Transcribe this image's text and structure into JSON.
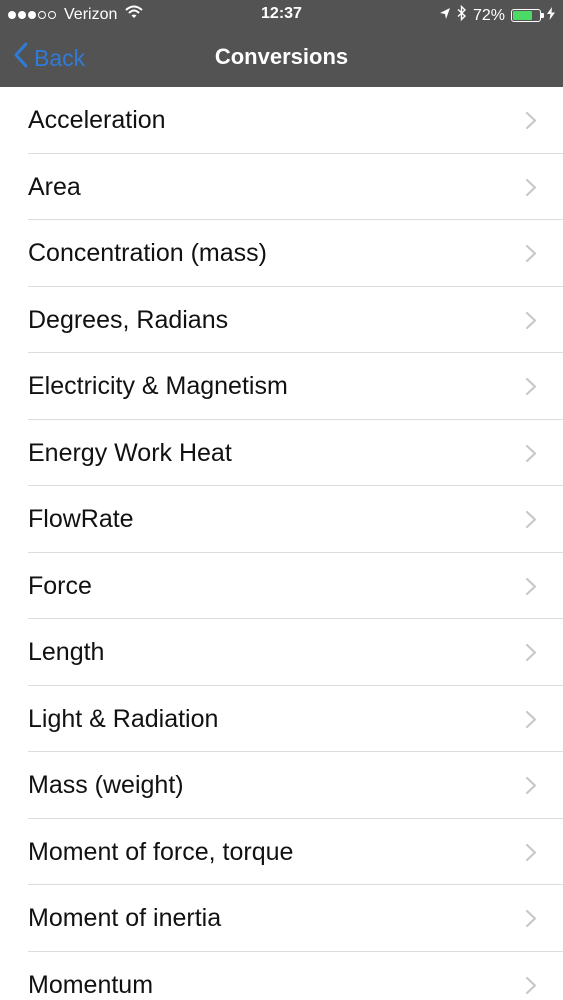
{
  "status_bar": {
    "carrier": "Verizon",
    "time": "12:37",
    "battery_percent_label": "72%",
    "battery_level": 0.72,
    "signal_bars_filled": 3,
    "signal_bars_total": 5
  },
  "nav": {
    "back_label": "Back",
    "title": "Conversions"
  },
  "colors": {
    "nav_background": "#535353",
    "accent": "#2f7bd8",
    "battery": "#4cd964"
  },
  "list": {
    "items": [
      {
        "label": "Acceleration"
      },
      {
        "label": "Area"
      },
      {
        "label": "Concentration (mass)"
      },
      {
        "label": "Degrees, Radians"
      },
      {
        "label": "Electricity & Magnetism"
      },
      {
        "label": "Energy Work Heat"
      },
      {
        "label": "FlowRate"
      },
      {
        "label": "Force"
      },
      {
        "label": "Length"
      },
      {
        "label": "Light & Radiation"
      },
      {
        "label": "Mass (weight)"
      },
      {
        "label": "Moment of force, torque"
      },
      {
        "label": "Moment of inertia"
      },
      {
        "label": "Momentum"
      }
    ]
  }
}
